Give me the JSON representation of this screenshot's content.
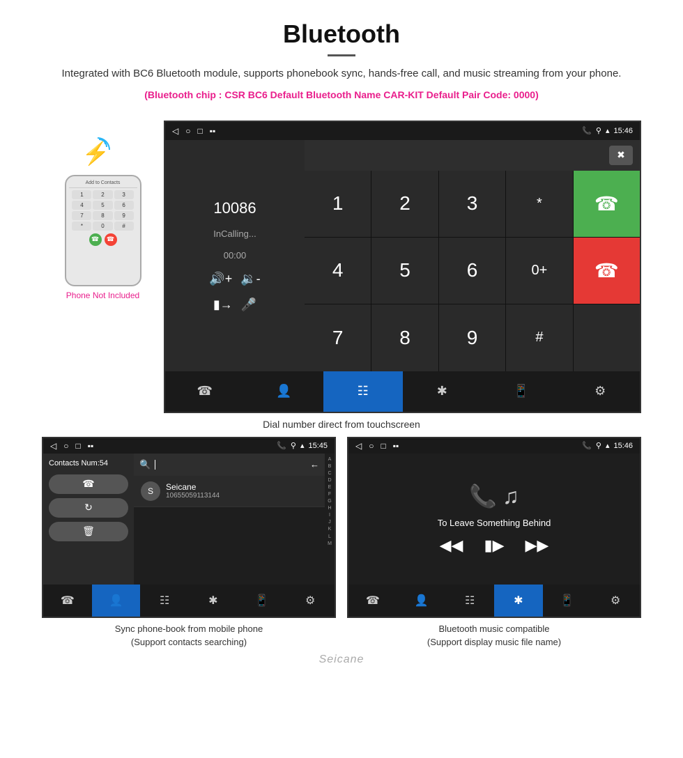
{
  "header": {
    "title": "Bluetooth",
    "description": "Integrated with BC6 Bluetooth module, supports phonebook sync, hands-free call, and music streaming from your phone.",
    "specs": "(Bluetooth chip : CSR BC6    Default Bluetooth Name CAR-KIT    Default Pair Code: 0000)"
  },
  "phone_aside": {
    "label": "Phone Not Included",
    "add_contacts_label": "Add to Contacts"
  },
  "main_screen": {
    "status_bar": {
      "left_icons": [
        "◁",
        "○",
        "□",
        "📁"
      ],
      "right": "15:46"
    },
    "dialer": {
      "number": "10086",
      "calling_label": "InCalling...",
      "timer": "00:00"
    },
    "numpad_keys": [
      "1",
      "2",
      "3",
      "*",
      "4",
      "5",
      "6",
      "0+",
      "7",
      "8",
      "9",
      "#"
    ],
    "caption": "Dial number direct from touchscreen"
  },
  "contacts_screen": {
    "status_right": "15:45",
    "contacts_num": "Contacts Num:54",
    "contact_name": "Seicane",
    "contact_number": "10655059113144",
    "alpha_letters": [
      "A",
      "B",
      "C",
      "D",
      "E",
      "F",
      "G",
      "H",
      "I",
      "J",
      "K",
      "L",
      "M"
    ],
    "caption_line1": "Sync phone-book from mobile phone",
    "caption_line2": "(Support contacts searching)"
  },
  "music_screen": {
    "status_right": "15:46",
    "song_title": "To Leave Something Behind",
    "caption_line1": "Bluetooth music compatible",
    "caption_line2": "(Support display music file name)"
  },
  "nav_items": {
    "phone": "📞",
    "contacts": "👤",
    "keypad": "⌨",
    "bluetooth": "✱",
    "transfer": "📱",
    "settings": "⚙"
  },
  "watermark": "Seicane"
}
